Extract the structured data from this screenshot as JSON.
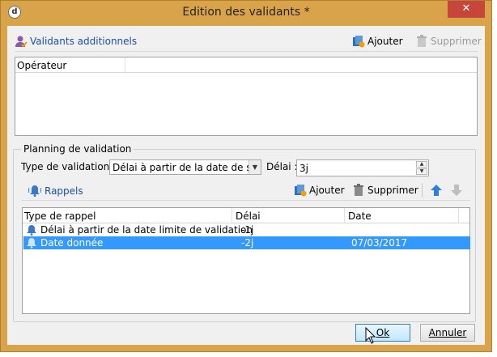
{
  "window": {
    "title": "Edition des validants *",
    "close_glyph": "✕",
    "app_icon_glyph": "d"
  },
  "validants_section": {
    "label": "Validants additionnels",
    "add_label": "Ajouter",
    "delete_label": "Supprimer",
    "columns": [
      "Opérateur"
    ]
  },
  "planning": {
    "group_title": "Planning de validation",
    "validation_type_label": "Type de validation :",
    "validation_type_value": "Délai à partir de la date de soum",
    "delay_label": "Délai :",
    "delay_value": "3j"
  },
  "reminders": {
    "label": "Rappels",
    "add_label": "Ajouter",
    "delete_label": "Supprimer",
    "columns": [
      "Type de rappel",
      "Délai",
      "Date"
    ],
    "rows": [
      {
        "type": "Délai à partir de la date limite de validation",
        "delay": "-1j",
        "date": "",
        "selected": false
      },
      {
        "type": "Date donnée",
        "delay": "-2j",
        "date": "07/03/2017",
        "selected": true
      }
    ]
  },
  "footer": {
    "ok_label": "Ok",
    "cancel_label": "Annuler"
  },
  "colors": {
    "title_bar": "#d9a349",
    "close_button": "#c7463c",
    "selection": "#3399ff",
    "link_blue": "#1f4ea3"
  }
}
